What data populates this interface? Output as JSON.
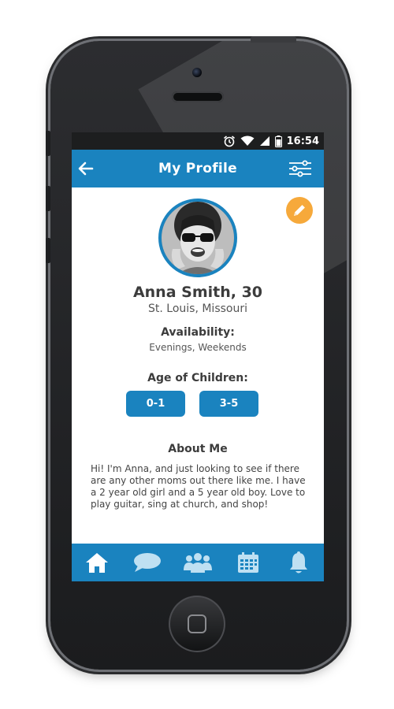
{
  "status_bar": {
    "time": "16:54"
  },
  "app_bar": {
    "title": "My Profile"
  },
  "profile": {
    "name": "Anna Smith, 30",
    "location": "St. Louis, Missouri",
    "availability_heading": "Availability:",
    "availability_value": "Evenings, Weekends",
    "age_heading": "Age of Children:",
    "age_chips": [
      "0-1",
      "3-5"
    ],
    "about_heading": "About Me",
    "about_text": "Hi! I'm Anna, and just looking to see if there are any other moms out there like me.  I have a 2 year old girl and a 5 year old boy.  Love to play guitar, sing at church, and shop!"
  },
  "bottom_nav": {
    "items": [
      {
        "icon": "home-icon",
        "active": true
      },
      {
        "icon": "chat-icon",
        "active": false
      },
      {
        "icon": "group-icon",
        "active": false
      },
      {
        "icon": "calendar-icon",
        "active": false
      },
      {
        "icon": "bell-icon",
        "active": false
      }
    ]
  },
  "colors": {
    "primary": "#1a83bf",
    "accent": "#f6a93b",
    "nav_active": "#ffffff",
    "nav_inactive": "#bfe0f2"
  }
}
